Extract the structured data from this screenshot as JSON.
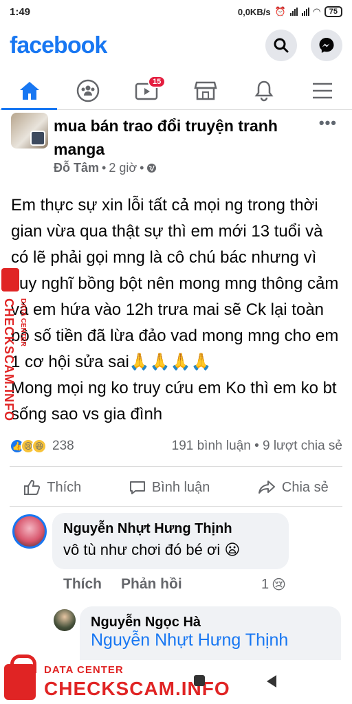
{
  "status_bar": {
    "time": "1:49",
    "net_speed": "0,0KB/s",
    "battery": "75"
  },
  "header": {
    "logo": "facebook",
    "icons": [
      "search-icon",
      "messenger-icon"
    ]
  },
  "nav": {
    "tabs": [
      {
        "icon": "home-icon",
        "active": true
      },
      {
        "icon": "groups-icon",
        "active": false
      },
      {
        "icon": "watch-icon",
        "active": false,
        "badge": "15"
      },
      {
        "icon": "marketplace-icon",
        "active": false
      },
      {
        "icon": "bell-icon",
        "active": false
      },
      {
        "icon": "menu-icon",
        "active": false
      }
    ]
  },
  "post": {
    "group_name": "mua bán trao đổi truyện tranh manga",
    "author": "Đỗ Tâm",
    "time": "2 giờ",
    "body_1": "Em thực sự xin lỗi tất cả mọi ng trong thời gian vừa qua thật sự thì em mới 13 tuổi và có lẽ phải gọi mng là cô chú bác nhưng vì suy nghĩ bồng bột nên mong mng thông cảm và em hứa vào 12h trưa mai sẽ Ck lại toàn bộ số tiền đã lừa đảo vad mong mng cho em 1 cơ hội sửa sai🙏🙏🙏🙏",
    "body_2": "Mong mọi ng ko truy cứu em Ko thì em ko bt sống sao vs gia đình",
    "reaction_count": "238",
    "comment_share": "191 bình luận • 9 lượt chia sẻ"
  },
  "actions": {
    "like": "Thích",
    "comment": "Bình luận",
    "share": "Chia sẻ"
  },
  "comments": [
    {
      "name": "Nguyễn Nhựt Hưng Thịnh",
      "text": "vô tù như chơi đó bé ơi 😦",
      "like_label": "Thích",
      "reply_label": "Phản hồi",
      "reaction_count": "1"
    },
    {
      "name": "Nguyễn Ngọc Hà",
      "mention": "Nguyễn Nhựt Hưng Thịnh"
    }
  ],
  "watermark": {
    "small": "DATA CENTER",
    "big": "CHECKSCAM.INFO"
  },
  "colors": {
    "brand": "#1877f2",
    "watermark": "#e02424"
  }
}
